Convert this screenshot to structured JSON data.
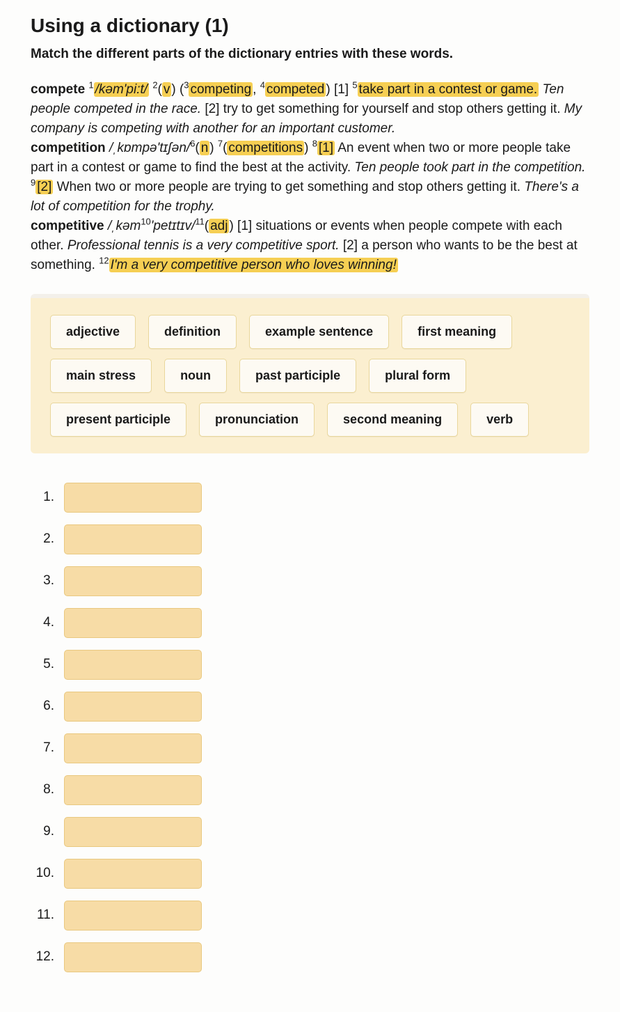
{
  "title": "Using a dictionary (1)",
  "instructions": "Match the different parts of the dictionary entries with these words.",
  "entries": {
    "e1": {
      "word": "compete",
      "s1": "1",
      "pron": "/kəm'pi:t/",
      "s2": "2",
      "pos": "v",
      "s3": "3",
      "pform": "competing",
      "comma": ", ",
      "s4": "4",
      "past": "competed",
      "sense1n": " [1] ",
      "s5": "5",
      "def1": "take part in a contest or game.",
      "ex1": " Ten people competed in the race.",
      "sense2": " [2] try to get something for yourself and stop others getting it. ",
      "ex2": "My company is competing with another for an important customer."
    },
    "e2": {
      "word": "competition",
      "pron_pre": " /ˌkɒmpə'tɪʃən/",
      "s6": "6",
      "pos": "n",
      "s7": "7",
      "plural": "competitions",
      "s8": "8",
      "sense1b": "[1]",
      "def1": " An event when two or more people take part in a contest or game to find the best at the activity. ",
      "ex1": "Ten people took part in the competition.",
      "s9": "9",
      "sense2b": "[2]",
      "def2": " When two or more people are trying to get something and stop others getting it. ",
      "ex2": "There's a lot of competition for the trophy."
    },
    "e3": {
      "word": "competitive",
      "pron_a": " /ˌkəm",
      "s10": "10",
      "pron_b": "'petɪtɪv/",
      "s11": "11",
      "pos": "adj",
      "def1": " [1] situations or events when people compete with each other. ",
      "ex1": "Professional tennis is a very competitive sport.",
      "def2": " [2] a person who wants to be the best at something. ",
      "s12": "12",
      "ex2": "I'm a very competitive person who loves winning!"
    }
  },
  "wordbank": [
    "adjective",
    "definition",
    "example sentence",
    "first meaning",
    "main stress",
    "noun",
    "past participle",
    "plural form",
    "present participle",
    "pronunciation",
    "second meaning",
    "verb"
  ],
  "answer_count": 12
}
